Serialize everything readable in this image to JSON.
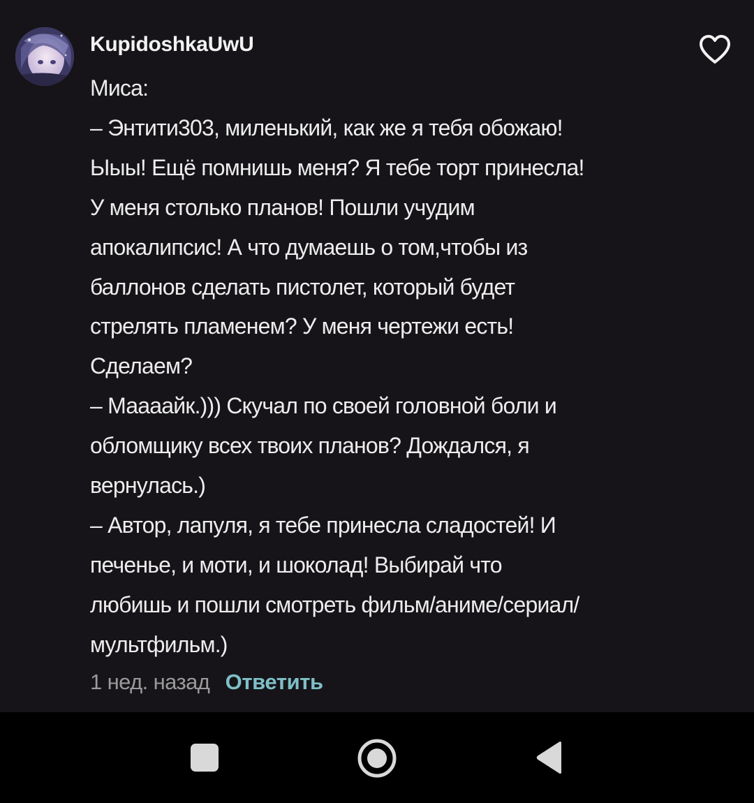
{
  "comment": {
    "username": "KupidoshkaUwU",
    "lines": [
      "Миса:",
      "– Энтити303, миленький, как же я тебя обожаю!",
      "Ыыы! Ещё помнишь меня? Я тебе торт принесла!",
      "У меня столько планов! Пошли учудим",
      "апокалипсис! А что думаешь о том,чтобы из",
      "баллонов сделать пистолет, который будет",
      "стрелять пламенем? У меня чертежи есть!",
      "Сделаем?",
      "– Маааайк.))) Скучал по своей головной боли и",
      "обломщику всех твоих планов? Дождался, я",
      "вернулась.)",
      "– Автор, лапуля, я тебе принесла сладостей! И",
      "печенье, и моти, и шоколад! Выбирай что",
      "любишь и пошли смотреть фильм/аниме/сериал/",
      "мультфильм.)"
    ],
    "timestamp": "1 нед. назад",
    "reply_label": "Ответить",
    "like_icon": "heart-outline-icon"
  },
  "navbar": {
    "recents_icon": "square-icon",
    "home_icon": "circle-home-icon",
    "back_icon": "triangle-back-icon"
  },
  "colors": {
    "background": "#161418",
    "navbar": "#000000",
    "username": "#f2f2f2",
    "text": "#ededed",
    "timestamp": "#9a9a9a",
    "reply": "#7fbfc7",
    "icon": "#d9d9d9"
  }
}
